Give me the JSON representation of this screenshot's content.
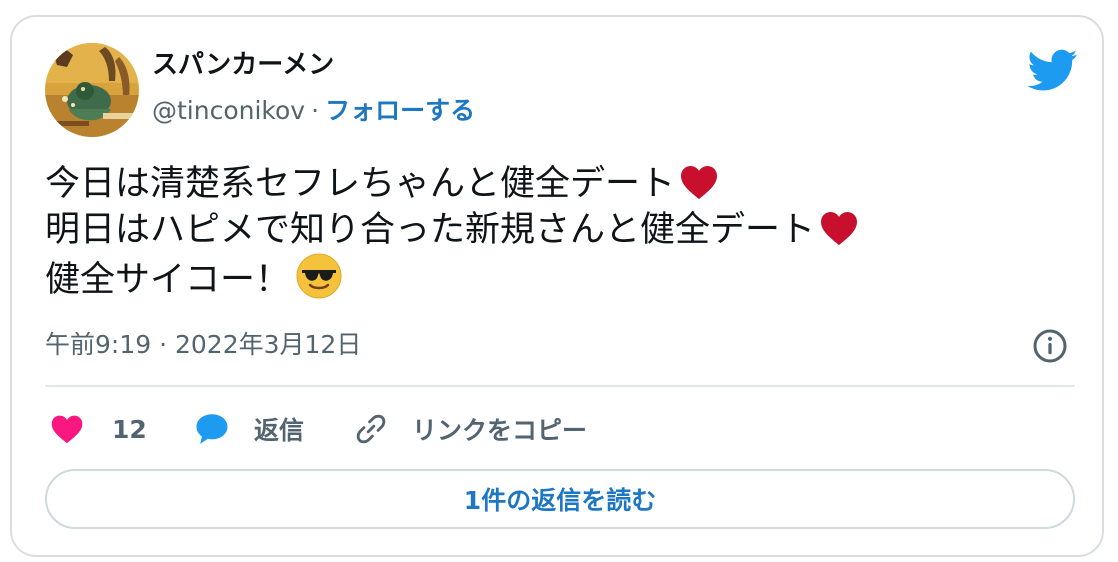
{
  "user": {
    "display_name": "スパンカーメン",
    "handle": "@tinconikov",
    "separator": "·",
    "follow_label": "フォローする"
  },
  "tweet": {
    "lines": [
      "今日は清楚系セフレちゃんと健全デート",
      "明日はハピメで知り合った新規さんと健全デート",
      "健全サイコー！"
    ],
    "line_emojis": [
      "red-heart",
      "red-heart",
      "smiling-face-with-sunglasses"
    ],
    "timestamp": "午前9:19 · 2022年3月12日"
  },
  "actions": {
    "like_count": "12",
    "reply_label": "返信",
    "copy_link_label": "リンクをコピー"
  },
  "footer": {
    "read_replies_label": "1件の返信を読む"
  },
  "colors": {
    "link_blue": "#1d77c2",
    "twitter_blue": "#1d9bf0",
    "like_pink": "#f91880",
    "heart_red": "#c8102e",
    "muted_text": "#536471",
    "main_text": "#0f1419",
    "border": "#d9dde1"
  },
  "icons": {
    "brand": "twitter-bird-icon",
    "info": "info-circle-icon",
    "like": "heart-icon",
    "reply": "speech-bubble-icon",
    "copy": "link-icon"
  }
}
